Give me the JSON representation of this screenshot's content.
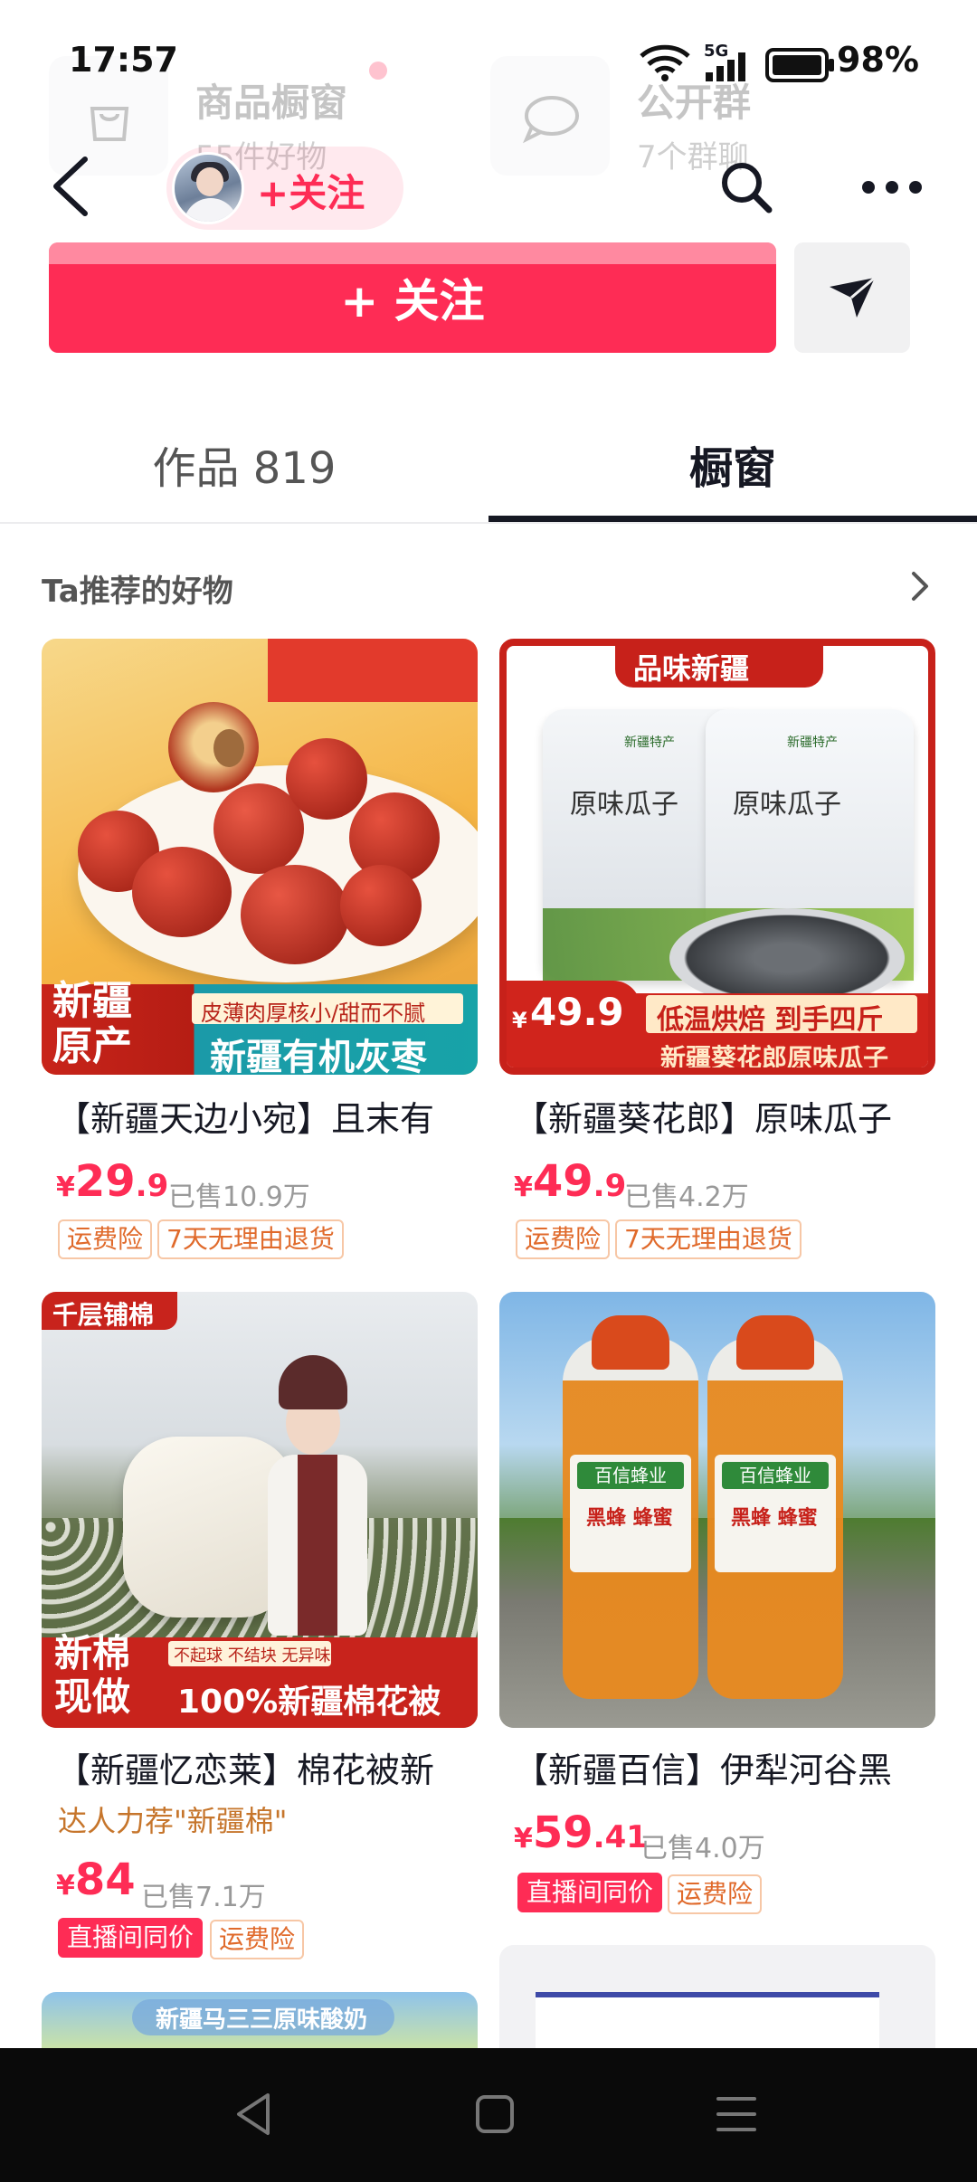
{
  "status": {
    "time": "17:57",
    "network": "5G",
    "battery": "98%"
  },
  "background_header": {
    "shop_window_title": "商品橱窗",
    "shop_window_sub": "55件好物",
    "group_title": "公开群",
    "group_sub": "7个群聊"
  },
  "nav": {
    "follow_label": "+关注"
  },
  "follow_button": {
    "label": "+ 关注"
  },
  "tabs": [
    {
      "label": "作品 819"
    },
    {
      "label": "橱窗"
    }
  ],
  "section": {
    "title": "Ta推荐的好物"
  },
  "products": [
    {
      "title": "【新疆天边小宛】且末有",
      "price_int": "29",
      "price_dec": ".9",
      "currency": "¥",
      "sold": "已售10.9万",
      "tags": [
        "运费险",
        "7天无理由退货"
      ],
      "image_text": {
        "corner": "新疆\n原产",
        "band_top": "皮薄肉厚核小/甜而不腻",
        "band": "新疆有机灰枣"
      }
    },
    {
      "title": "【新疆葵花郎】原味瓜子",
      "price_int": "49",
      "price_dec": ".9",
      "currency": "¥",
      "sold": "已售4.2万",
      "tags": [
        "运费险",
        "7天无理由退货"
      ],
      "image_text": {
        "top": "品味新疆",
        "price": "49.9",
        "price_cur": "¥",
        "promo": "低温烘焙 到手四斤",
        "band": "新疆葵花郎原味瓜子",
        "bag": "原味瓜子",
        "bag_brand": "新疆特产"
      }
    },
    {
      "title": "【新疆忆恋莱】棉花被新",
      "subtitle": "达人力荐\"新疆棉\"",
      "price_int": "84",
      "price_dec": "",
      "currency": "¥",
      "sold": "已售7.1万",
      "tags": [
        "直播间同价",
        "运费险"
      ],
      "image_text": {
        "corner_top": "千层铺棉",
        "corner": "新棉\n现做",
        "band_top": "不起球 不结块 无异味",
        "band": "100%新疆棉花被"
      }
    },
    {
      "title": "【新疆百信】伊犁河谷黑",
      "price_int": "59",
      "price_dec": ".41",
      "currency": "¥",
      "sold": "已售4.0万",
      "tags": [
        "直播间同价",
        "运费险"
      ],
      "image_text": {
        "label_brand": "百信蜂业",
        "label_name": "黑蜂 蜂蜜"
      }
    }
  ],
  "peek": {
    "yogurt_banner": "新疆马三三原味酸奶"
  },
  "colors": {
    "accent": "#fe2c55",
    "tag_border": "#f7c7a6",
    "tag_text": "#e06a2b",
    "text": "#161823"
  }
}
